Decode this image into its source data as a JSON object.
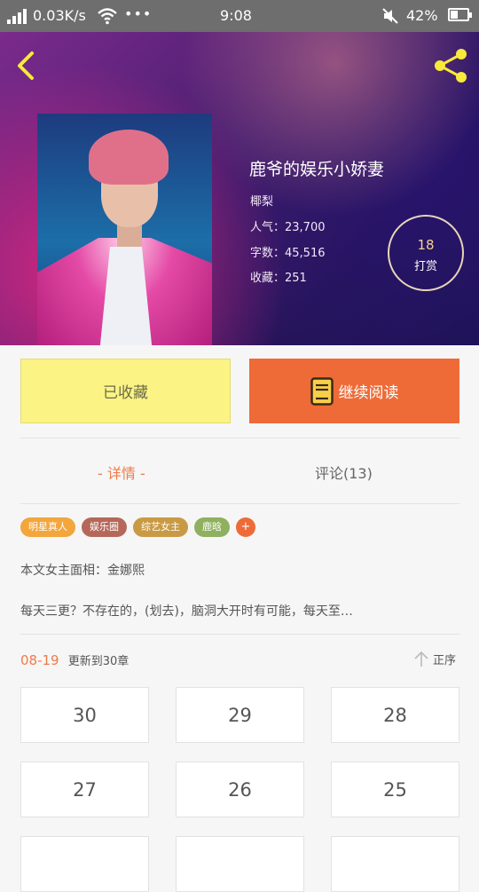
{
  "status_bar": {
    "network_speed": "0.03K/s",
    "dots": "•••",
    "time": "9:08",
    "battery_percent": "42%",
    "battery_level": 0.42
  },
  "book": {
    "title": "鹿爷的娱乐小娇妻",
    "author": "椰梨",
    "popularity": "人气：23,700",
    "word_count": "字数：45,516",
    "favorites": "收藏：251",
    "reward_count": "18",
    "reward_label": "打赏"
  },
  "actions": {
    "collected_label": "已收藏",
    "continue_label": "继续阅读"
  },
  "tabs": {
    "detail": "- 详情 -",
    "comments": "评论(13)"
  },
  "tags": [
    {
      "label": "明星真人",
      "color": "#f2a63c"
    },
    {
      "label": "娱乐圈",
      "color": "#b5685a"
    },
    {
      "label": "综艺女主",
      "color": "#c99a45"
    },
    {
      "label": "鹿晗",
      "color": "#8fb05e"
    },
    {
      "label": "+",
      "color": "#ee6b37"
    }
  ],
  "description": {
    "line1": "本文女主面相：金娜熙",
    "line2": "每天三更？不存在的，(划去)，脑洞大开时有可能，每天至…"
  },
  "update": {
    "date": "08-19",
    "text": "更新到30章",
    "sort_label": "正序"
  },
  "chapters": [
    "30",
    "29",
    "28",
    "27",
    "26",
    "25",
    "",
    "",
    ""
  ],
  "colors": {
    "accent_orange": "#ee6b37",
    "collected_yellow": "#fbf384",
    "tab_active": "#ee7b4a"
  }
}
